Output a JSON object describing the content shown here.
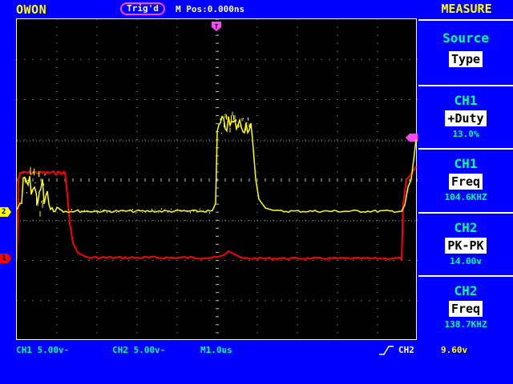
{
  "brand": "OWON",
  "top_bar": {
    "trigger_status": "Trig'd",
    "m_pos": "M Pos:0.000ns",
    "menu_title": "MEASURE"
  },
  "menu": {
    "source": {
      "heading": "Source",
      "button": "Type"
    },
    "items": [
      {
        "channel": "CH1",
        "type": "+Duty",
        "value": "13.0%"
      },
      {
        "channel": "CH1",
        "type": "Freq",
        "value": "104.6KHZ"
      },
      {
        "channel": "CH2",
        "type": "PK-PK",
        "value": "14.00v"
      },
      {
        "channel": "CH2",
        "type": "Freq",
        "value": "138.7KHZ"
      }
    ]
  },
  "status_bar": {
    "ch1_scale": "CH1 5.00v-",
    "ch2_scale": "CH2 5.00v-",
    "timebase": "M1.0us",
    "trigger_source": "CH2",
    "trigger_level": "9.60v"
  },
  "markers": {
    "ch1": "1",
    "ch2": "2"
  },
  "colors": {
    "background": "#0000ff",
    "ch1_trace": "#ff0000",
    "ch2_trace": "#ffff00",
    "accent": "#00ff99",
    "trigger_marker": "#ff44ff"
  }
}
